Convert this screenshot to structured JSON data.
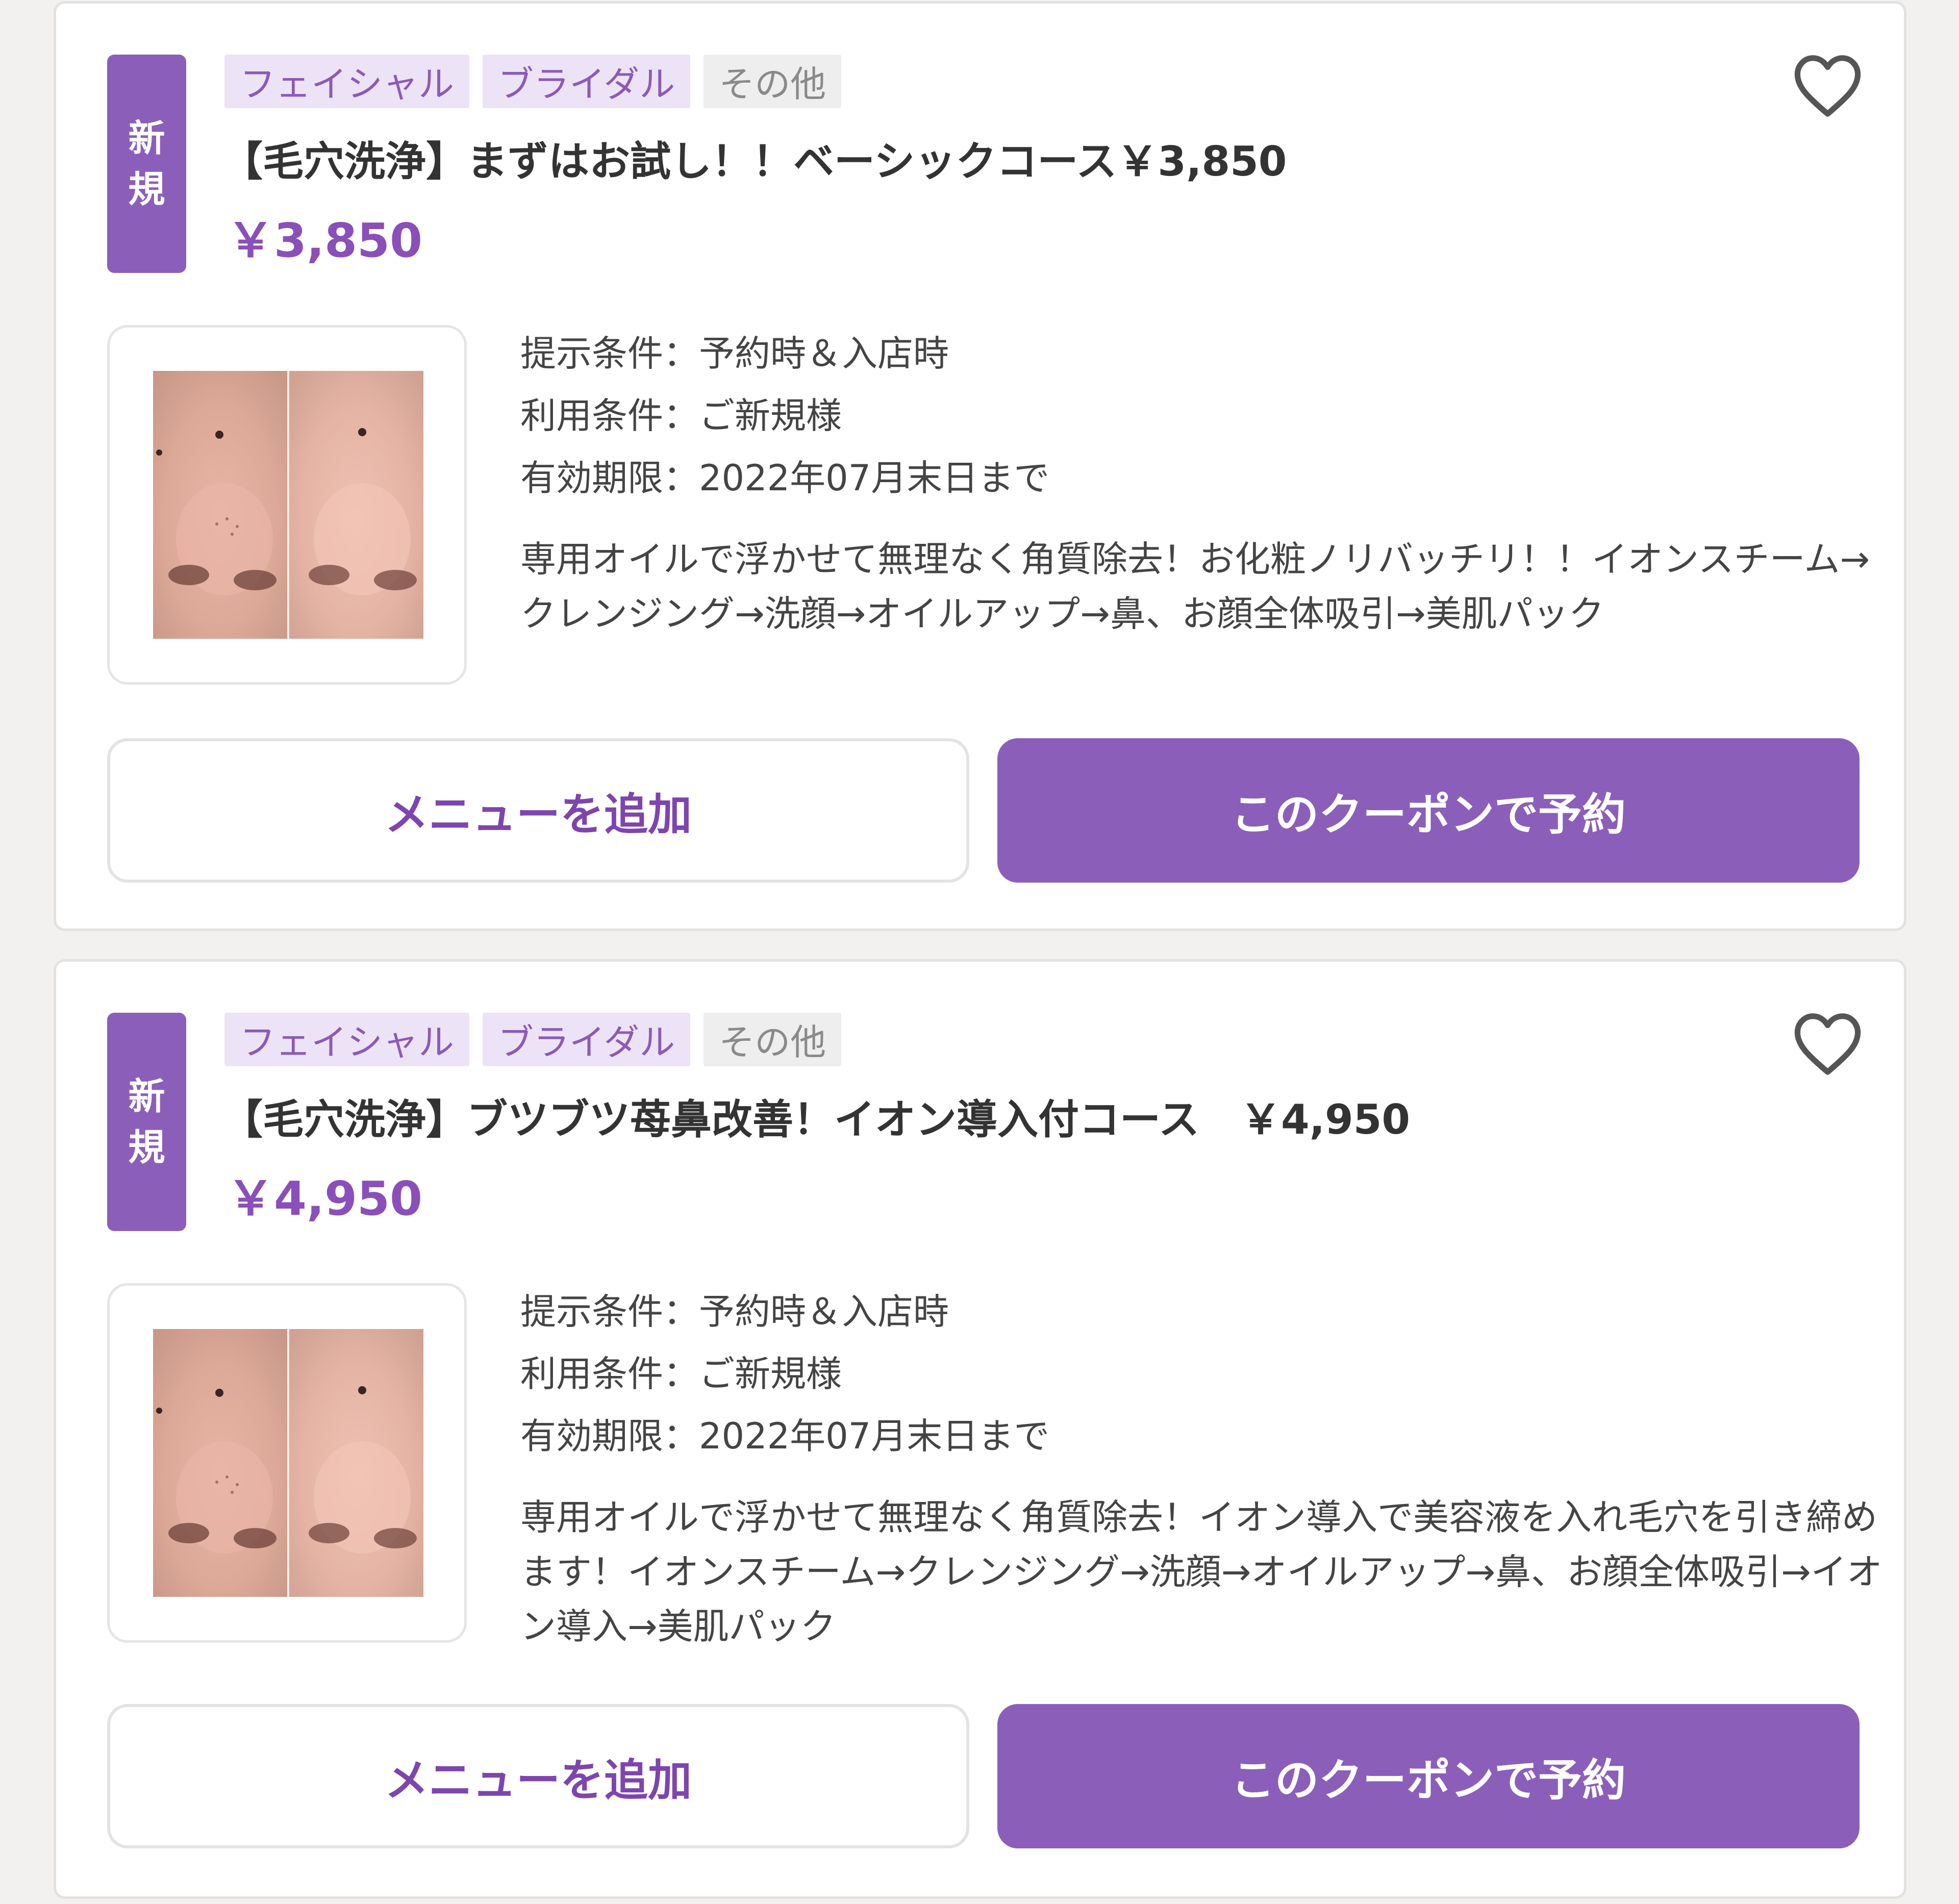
{
  "colors": {
    "accent": "#8b5fb9",
    "price": "#8a4fb8",
    "tag_purple_bg": "#ede3f6",
    "tag_gray_bg": "#eeeeee"
  },
  "coupons": [
    {
      "badge": [
        "新",
        "規"
      ],
      "tags": [
        "フェイシャル",
        "ブライダル",
        "その他"
      ],
      "title": "【毛穴洗浄】まずはお試し！！ベーシックコース￥3,850",
      "price": "￥3,850",
      "conditions": [
        "提示条件：予約時＆入店時",
        "利用条件：ご新規様",
        "有効期限：2022年07月末日まで"
      ],
      "description": "専用オイルで浮かせて無理なく角質除去！お化粧ノリバッチリ！！イオンスチーム→クレンジング→洗顔→オイルアップ→鼻、お顔全体吸引→美肌パック",
      "add_menu_label": "メニューを追加",
      "reserve_label": "このクーポンで予約",
      "favorite_icon": "heart-outline-icon"
    },
    {
      "badge": [
        "新",
        "規"
      ],
      "tags": [
        "フェイシャル",
        "ブライダル",
        "その他"
      ],
      "title": "【毛穴洗浄】ブツブツ苺鼻改善！イオン導入付コース　￥4,950",
      "price": "￥4,950",
      "conditions": [
        "提示条件：予約時＆入店時",
        "利用条件：ご新規様",
        "有効期限：2022年07月末日まで"
      ],
      "description": "専用オイルで浮かせて無理なく角質除去！イオン導入で美容液を入れ毛穴を引き締めます！イオンスチーム→クレンジング→洗顔→オイルアップ→鼻、お顔全体吸引→イオン導入→美肌パック",
      "add_menu_label": "メニューを追加",
      "reserve_label": "このクーポンで予約",
      "favorite_icon": "heart-outline-icon"
    }
  ]
}
